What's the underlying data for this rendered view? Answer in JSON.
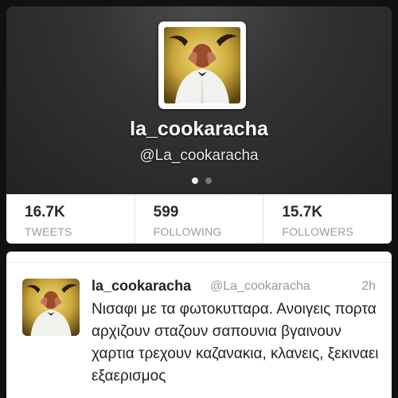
{
  "profile": {
    "display_name": "la_cookaracha",
    "handle": "@La_cookaracha",
    "avatar": "profile-photo",
    "pager": {
      "pages": 2,
      "current": 1
    }
  },
  "stats": [
    {
      "value": "16.7K",
      "label": "TWEETS"
    },
    {
      "value": "599",
      "label": "FOLLOWING"
    },
    {
      "value": "15.7K",
      "label": "FOLLOWERS"
    }
  ],
  "tweet": {
    "name": "la_cookaracha",
    "handle": "@La_cookaracha",
    "time": "2h",
    "text": "Νισαφι με τα φωτοκυτταρα. Ανοιγεις πορτα αρχιζουν σταζουν σαπουνια βγαινουν χαρτια τρεχουν καζανακια, κλανεις, ξεκιναει εξαερισμος"
  },
  "colors": {
    "header_bg": "#333333",
    "text_dark": "#222222",
    "text_muted": "#9a9a9a"
  }
}
